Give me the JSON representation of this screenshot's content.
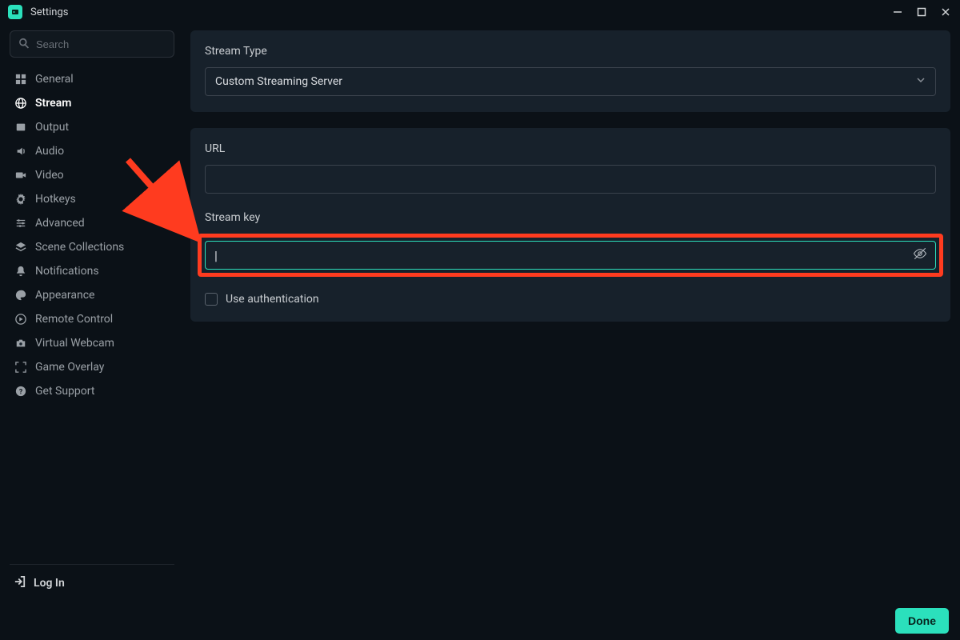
{
  "window": {
    "title": "Settings"
  },
  "search": {
    "placeholder": "Search"
  },
  "sidebar": {
    "items": [
      {
        "label": "General"
      },
      {
        "label": "Stream"
      },
      {
        "label": "Output"
      },
      {
        "label": "Audio"
      },
      {
        "label": "Video"
      },
      {
        "label": "Hotkeys"
      },
      {
        "label": "Advanced"
      },
      {
        "label": "Scene Collections"
      },
      {
        "label": "Notifications"
      },
      {
        "label": "Appearance"
      },
      {
        "label": "Remote Control"
      },
      {
        "label": "Virtual Webcam"
      },
      {
        "label": "Game Overlay"
      },
      {
        "label": "Get Support"
      }
    ],
    "login": "Log In"
  },
  "stream": {
    "type_label": "Stream Type",
    "type_value": "Custom Streaming Server",
    "url_label": "URL",
    "url_value": "",
    "key_label": "Stream key",
    "key_value": "",
    "auth_label": "Use authentication"
  },
  "footer": {
    "done": "Done"
  },
  "colors": {
    "accent": "#2be0bc",
    "highlight": "#ff3b1f"
  }
}
